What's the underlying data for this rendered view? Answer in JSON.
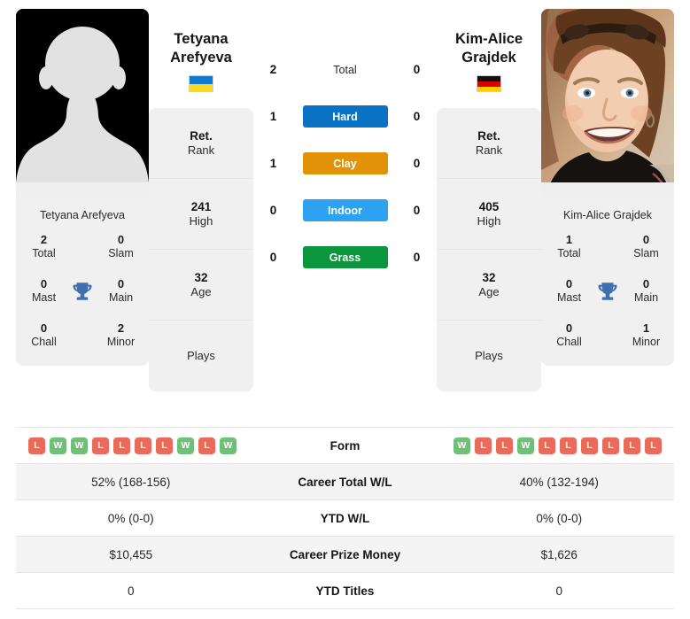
{
  "players": {
    "left": {
      "first_name": "Tetyana",
      "last_name": "Arefyeva",
      "full_name": "Tetyana Arefyeva",
      "country": "Ukraine",
      "flag_icon": "flag-ukraine-icon",
      "photo_type": "placeholder-avatar",
      "titles": {
        "total_value": "2",
        "total_label": "Total",
        "slam_value": "0",
        "slam_label": "Slam",
        "mast_value": "0",
        "mast_label": "Mast",
        "main_value": "0",
        "main_label": "Main",
        "chall_value": "0",
        "chall_label": "Chall",
        "minor_value": "2",
        "minor_label": "Minor"
      },
      "ranking": [
        {
          "value": "Ret.",
          "label": "Rank"
        },
        {
          "value": "241",
          "label": "High"
        },
        {
          "value": "32",
          "label": "Age"
        },
        {
          "value": "",
          "label": "Plays"
        }
      ],
      "surface_titles": {
        "total": "2",
        "hard": "1",
        "clay": "1",
        "indoor": "0",
        "grass": "0"
      },
      "form": [
        "L",
        "W",
        "W",
        "L",
        "L",
        "L",
        "L",
        "W",
        "L",
        "W"
      ],
      "career_total_wl": "52% (168-156)",
      "ytd_wl": "0% (0-0)",
      "career_prize_money": "$10,455",
      "ytd_titles": "0"
    },
    "right": {
      "first_name": "Kim-Alice",
      "last_name": "Grajdek",
      "full_name": "Kim-Alice Grajdek",
      "country": "Germany",
      "flag_icon": "flag-germany-icon",
      "photo_type": "player-portrait",
      "titles": {
        "total_value": "1",
        "total_label": "Total",
        "slam_value": "0",
        "slam_label": "Slam",
        "mast_value": "0",
        "mast_label": "Mast",
        "main_value": "0",
        "main_label": "Main",
        "chall_value": "0",
        "chall_label": "Chall",
        "minor_value": "1",
        "minor_label": "Minor"
      },
      "ranking": [
        {
          "value": "Ret.",
          "label": "Rank"
        },
        {
          "value": "405",
          "label": "High"
        },
        {
          "value": "32",
          "label": "Age"
        },
        {
          "value": "",
          "label": "Plays"
        }
      ],
      "surface_titles": {
        "total": "0",
        "hard": "0",
        "clay": "0",
        "indoor": "0",
        "grass": "0"
      },
      "form": [
        "W",
        "L",
        "L",
        "W",
        "L",
        "L",
        "L",
        "L",
        "L",
        "L"
      ],
      "career_total_wl": "40% (132-194)",
      "ytd_wl": "0% (0-0)",
      "career_prize_money": "$1,626",
      "ytd_titles": "0"
    }
  },
  "surfaces": [
    {
      "key": "total",
      "label": "Total",
      "color": "transparent",
      "text_color": "#272727"
    },
    {
      "key": "hard",
      "label": "Hard",
      "color": "#0a72c4",
      "text_color": "#ffffff"
    },
    {
      "key": "clay",
      "label": "Clay",
      "color": "#e29206",
      "text_color": "#ffffff"
    },
    {
      "key": "indoor",
      "label": "Indoor",
      "color": "#2da2f0",
      "text_color": "#ffffff"
    },
    {
      "key": "grass",
      "label": "Grass",
      "color": "#09963c",
      "text_color": "#ffffff"
    }
  ],
  "stats_rows": [
    {
      "label": "Form",
      "type": "form"
    },
    {
      "label": "Career Total W/L",
      "type": "text",
      "key": "career_total_wl"
    },
    {
      "label": "YTD W/L",
      "type": "text",
      "key": "ytd_wl"
    },
    {
      "label": "Career Prize Money",
      "type": "text",
      "key": "career_prize_money"
    },
    {
      "label": "YTD Titles",
      "type": "text",
      "key": "ytd_titles"
    }
  ],
  "colors": {
    "win_badge": "#71be79",
    "loss_badge": "#ec6a5a",
    "card_bg": "#f0f0f0",
    "row_alt_bg": "#f4f4f4",
    "trophy": "#3f6fad"
  },
  "icons": {
    "trophy": "trophy-icon"
  }
}
